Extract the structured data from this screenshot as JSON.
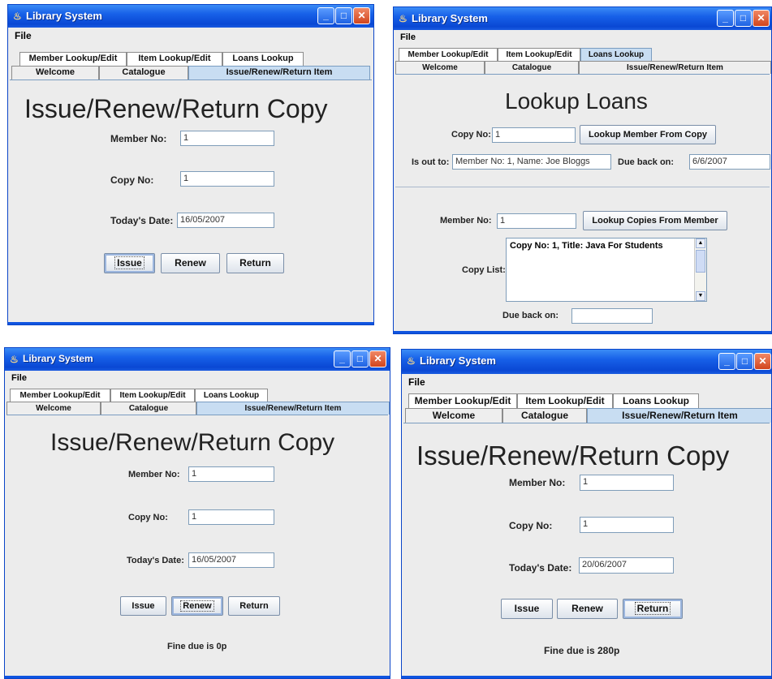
{
  "common": {
    "window_title": "Library System",
    "menu_file": "File",
    "tabs": {
      "member": "Member Lookup/Edit",
      "item": "Item Lookup/Edit",
      "loans": "Loans Lookup",
      "welcome": "Welcome",
      "catalogue": "Catalogue",
      "issue": "Issue/Renew/Return Item"
    },
    "colors": {
      "titlebar": "#0a48d4",
      "selected_tab": "#c8ddf2",
      "window_bg": "#ececec"
    }
  },
  "issue_win1": {
    "heading": "Issue/Renew/Return Copy",
    "member_label": "Member No:",
    "member_value": "1",
    "copy_label": "Copy No:",
    "copy_value": "1",
    "date_label": "Today's Date:",
    "date_value": "16/05/2007",
    "issue_btn": "Issue",
    "renew_btn": "Renew",
    "return_btn": "Return"
  },
  "lookup_win": {
    "heading": "Lookup Loans",
    "copy_label": "Copy No:",
    "copy_value": "1",
    "lookup_member_btn": "Lookup Member From Copy",
    "isout_label": "Is out to:",
    "isout_value": "Member No: 1, Name: Joe Bloggs",
    "dueback_label": "Due back on:",
    "dueback_value": "6/6/2007",
    "member_label": "Member No:",
    "member_value": "1",
    "lookup_copies_btn": "Lookup Copies From Member",
    "copylist_label": "Copy List:",
    "copylist_item": "Copy No: 1, Title: Java For Students",
    "dueback2_label": "Due back on:",
    "dueback2_value": ""
  },
  "issue_win2": {
    "heading": "Issue/Renew/Return Copy",
    "member_label": "Member No:",
    "member_value": "1",
    "copy_label": "Copy No:",
    "copy_value": "1",
    "date_label": "Today's Date:",
    "date_value": "16/05/2007",
    "issue_btn": "Issue",
    "renew_btn": "Renew",
    "return_btn": "Return",
    "fine": "Fine due is 0p"
  },
  "issue_win3": {
    "heading": "Issue/Renew/Return Copy",
    "member_label": "Member No:",
    "member_value": "1",
    "copy_label": "Copy No:",
    "copy_value": "1",
    "date_label": "Today's Date:",
    "date_value": "20/06/2007",
    "issue_btn": "Issue",
    "renew_btn": "Renew",
    "return_btn": "Return",
    "fine": "Fine due is 280p"
  }
}
